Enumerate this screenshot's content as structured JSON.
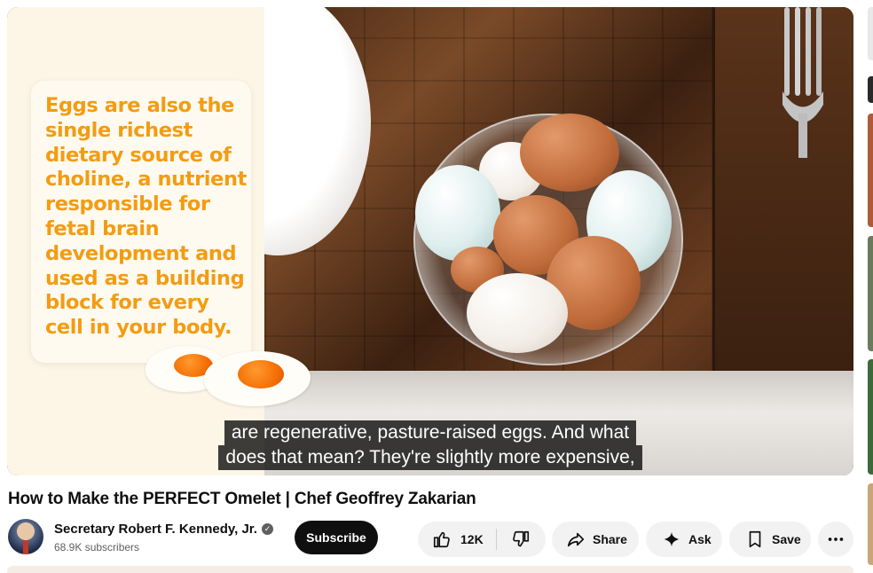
{
  "video": {
    "fact_text": "Eggs are also the single richest dietary source of choline, a nutrient responsible for fetal brain development and used as a building block for every cell in your body.",
    "caption_line1": "are regenerative, pasture-raised eggs. And what",
    "caption_line2": "does that mean? They're slightly more expensive,"
  },
  "title": "How to Make the PERFECT Omelet | Chef Geoffrey Zakarian",
  "channel": {
    "name": "Secretary Robert F. Kennedy, Jr.",
    "subscribers": "68.9K subscribers",
    "subscribe_label": "Subscribe"
  },
  "actions": {
    "like_count": "12K",
    "share_label": "Share",
    "ask_label": "Ask",
    "save_label": "Save"
  },
  "icons": {
    "like": "thumbs-up-icon",
    "dislike": "thumbs-down-icon",
    "share": "share-arrow-icon",
    "ask": "sparkle-icon",
    "save": "bookmark-icon",
    "more": "more-horizontal-icon",
    "verified": "verified-check-icon"
  },
  "colors": {
    "fact_text": "#f39c12",
    "subscribe_bg": "#0f0f0f",
    "pill_bg": "#f2f2f2"
  }
}
